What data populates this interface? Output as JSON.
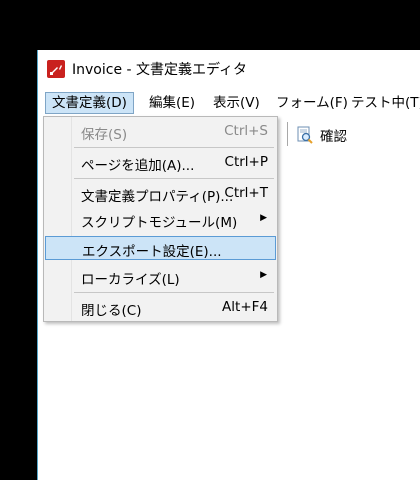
{
  "window": {
    "title": "Invoice - 文書定義エディタ"
  },
  "menubar": {
    "items": [
      {
        "label": "文書定義(D)"
      },
      {
        "label": "編集(E)"
      },
      {
        "label": "表示(V)"
      },
      {
        "label": "フォーム(F)"
      },
      {
        "label": "テスト中(T)"
      }
    ]
  },
  "toolbar": {
    "confirm_label": "確認"
  },
  "menu": {
    "items": [
      {
        "label": "保存(S)",
        "shortcut": "Ctrl+S",
        "disabled": true
      },
      {
        "label": "ページを追加(A)...",
        "shortcut": "Ctrl+P"
      },
      {
        "label": "文書定義プロパティ(P)...",
        "shortcut": "Ctrl+T"
      },
      {
        "label": "スクリプトモジュール(M)",
        "submenu": true
      },
      {
        "label": "エクスポート設定(E)...",
        "highlighted": true
      },
      {
        "label": "ローカライズ(L)",
        "submenu": true
      },
      {
        "label": "閉じる(C)",
        "shortcut": "Alt+F4"
      }
    ]
  }
}
